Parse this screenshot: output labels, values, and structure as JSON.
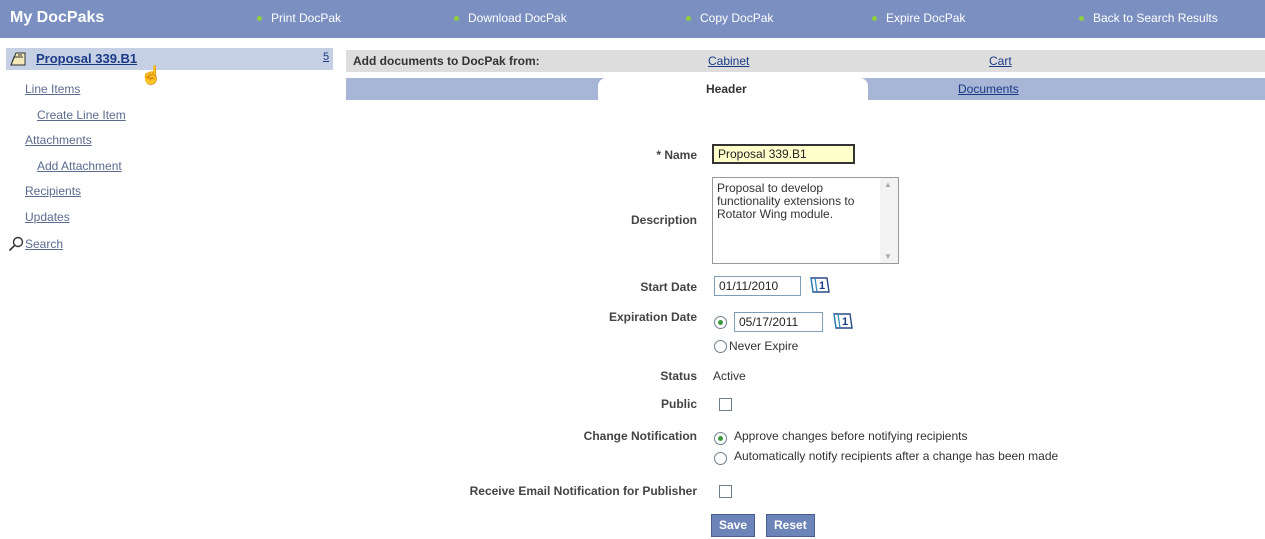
{
  "topbar": {
    "title": "My DocPaks",
    "nav": [
      "Print DocPak",
      "Download DocPak",
      "Copy DocPak",
      "Expire DocPak",
      "Back to Search Results"
    ]
  },
  "sidebar": {
    "active_item": "Proposal 339.B1",
    "active_count": "5",
    "links": {
      "line_items": "Line Items",
      "create_line_item": "Create Line Item",
      "attachments": "Attachments",
      "add_attachment": "Add Attachment",
      "recipients": "Recipients",
      "updates": "Updates",
      "search": "Search"
    }
  },
  "add_docs": {
    "label": "Add documents to DocPak from:",
    "cabinet": "Cabinet",
    "cart": "Cart"
  },
  "tabs": {
    "header": "Header",
    "documents": "Documents"
  },
  "form": {
    "name_label": "* Name",
    "name_value": "Proposal 339.B1",
    "description_label": "Description",
    "description_value": "Proposal to develop functionality extensions to Rotator Wing module.",
    "start_date_label": "Start Date",
    "start_date_value": "01/11/2010",
    "expiration_date_label": "Expiration Date",
    "expiration_date_value": "05/17/2011",
    "never_expire_label": "Never Expire",
    "status_label": "Status",
    "status_value": "Active",
    "public_label": "Public",
    "change_notification_label": "Change Notification",
    "change_option_1": "Approve changes before notifying recipients",
    "change_option_2": "Automatically notify recipients after a change has been made",
    "receive_email_label": "Receive Email Notification for Publisher",
    "save_label": "Save",
    "reset_label": "Reset"
  },
  "colors": {
    "topbar": "#7b90c0",
    "tab_strip": "#a7b5d6",
    "active_row": "#c6d0e4",
    "link": "#1a3a88",
    "button": "#6d84b8"
  }
}
